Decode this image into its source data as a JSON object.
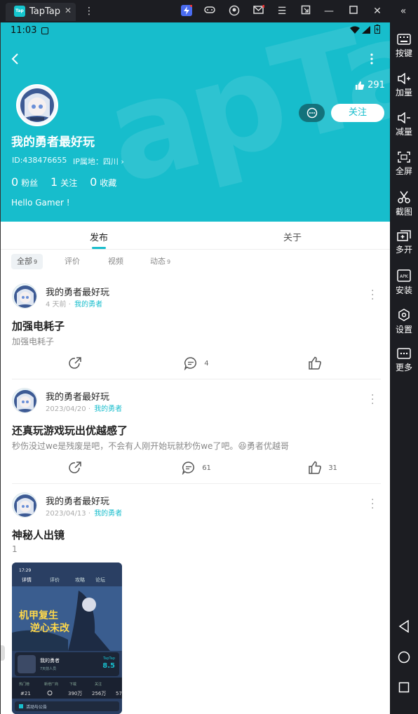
{
  "window": {
    "tab_title": "TapTap",
    "app_icon_text": "Tap"
  },
  "sidebar": {
    "items": [
      {
        "label": "按键",
        "icon": "keyboard-icon"
      },
      {
        "label": "加量",
        "icon": "volume-up-icon"
      },
      {
        "label": "减量",
        "icon": "volume-down-icon"
      },
      {
        "label": "全屏",
        "icon": "fullscreen-icon"
      },
      {
        "label": "截图",
        "icon": "scissors-icon"
      },
      {
        "label": "多开",
        "icon": "multi-instance-icon"
      },
      {
        "label": "安装",
        "icon": "apk-install-icon"
      },
      {
        "label": "设置",
        "icon": "settings-icon"
      },
      {
        "label": "更多",
        "icon": "more-icon"
      }
    ]
  },
  "status_bar": {
    "time": "11:03"
  },
  "profile": {
    "likes": "291",
    "follow_label": "关注",
    "username": "我的勇者最好玩",
    "id_text": "ID:438476655",
    "ip_text": "IP属地：四川",
    "stats": [
      {
        "value": "0",
        "label": "粉丝"
      },
      {
        "value": "1",
        "label": "关注"
      },
      {
        "value": "0",
        "label": "收藏"
      }
    ],
    "bio": "Hello Gamer !"
  },
  "tabs": [
    {
      "label": "发布"
    },
    {
      "label": "关于"
    }
  ],
  "filters": [
    {
      "label": "全部",
      "count": "9"
    },
    {
      "label": "评价",
      "count": ""
    },
    {
      "label": "视频",
      "count": ""
    },
    {
      "label": "动态",
      "count": "9"
    }
  ],
  "posts": [
    {
      "author": "我的勇者最好玩",
      "time": "4 天前",
      "game": "我的勇者",
      "title": "加强电耗子",
      "body": "加强电耗子",
      "comments": "4",
      "likes": ""
    },
    {
      "author": "我的勇者最好玩",
      "time": "2023/04/20",
      "game": "我的勇者",
      "title": "还真玩游戏玩出优越感了",
      "body": "秒伤没过we是残废是吧，不会有人刚开始玩就秒伤we了吧。😆勇者优越哥",
      "comments": "61",
      "likes": "31"
    },
    {
      "author": "我的勇者最好玩",
      "time": "2023/04/13",
      "game": "我的勇者",
      "title": "神秘人出镜",
      "body": "1",
      "comments": "",
      "likes": ""
    }
  ],
  "screenshot_thumb": {
    "time": "17:29",
    "tabs": [
      "详情",
      "评价",
      "攻略",
      "论坛"
    ],
    "banner_line1": "机甲复生",
    "banner_line2": "逆心未改",
    "game_name": "我的勇者",
    "game_sub": "7天前人员",
    "brand": "TapTap",
    "score": "8.5",
    "stats": [
      {
        "label": "热门榜",
        "value": "#21"
      },
      {
        "label": "新增厂商",
        "value": ""
      },
      {
        "label": "下载",
        "value": "390万"
      },
      {
        "label": "关注",
        "value": "256万"
      },
      {
        "label": "",
        "value": "57"
      }
    ],
    "bottom_label": "活动与公告"
  }
}
